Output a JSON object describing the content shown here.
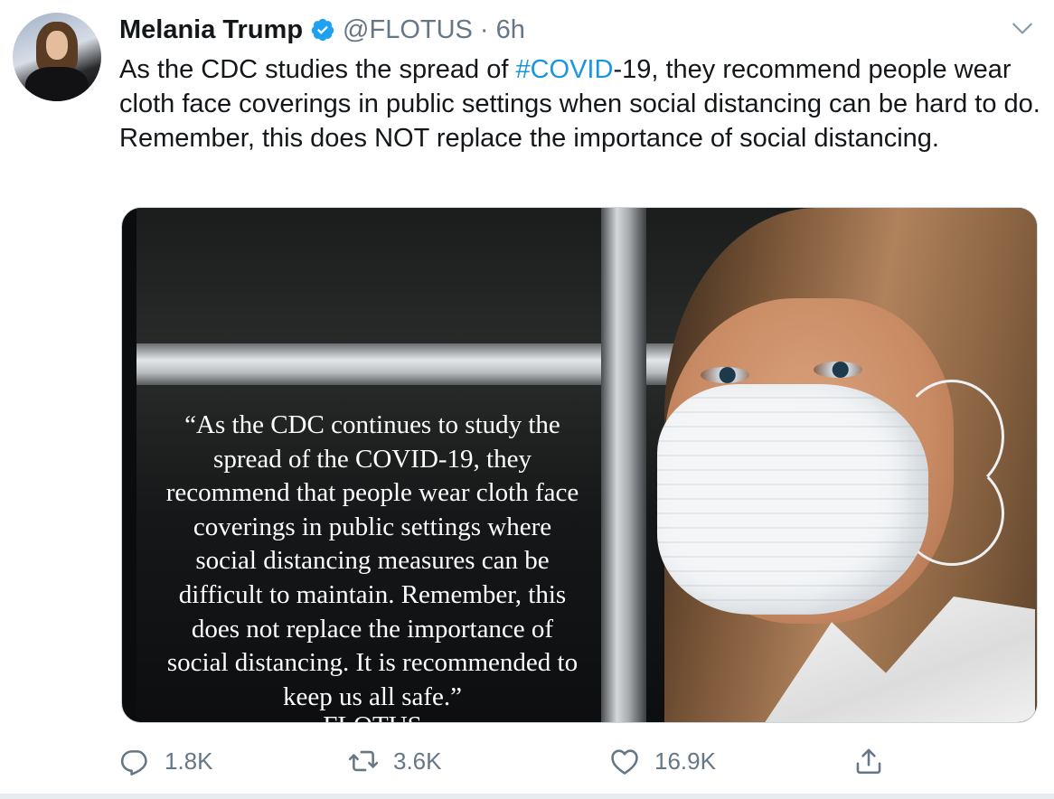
{
  "author": {
    "name": "Melania Trump",
    "handle": "@FLOTUS",
    "separator": "·",
    "time": "6h",
    "verified": true
  },
  "tweet": {
    "text_parts": {
      "before": "As the CDC studies the spread of ",
      "hashtag": "#COVID",
      "after": "-19, they recommend people wear cloth face coverings in public settings when social distancing can be hard to do. Remember, this does NOT replace the importance of social distancing."
    },
    "hashtag_color": "#1b95e0"
  },
  "media": {
    "quote_text": "“As the CDC continues to study the\nspread of the COVID-19, they\nrecommend that people wear cloth face\ncoverings in public settings where\nsocial distancing measures can be\ndifficult to maintain. Remember, this\ndoes not replace the importance of\nsocial distancing. It is recommended to\nkeep us all safe.”",
    "signature": "FLOTUS"
  },
  "actions": {
    "reply_count": "1.8K",
    "retweet_count": "3.6K",
    "like_count": "16.9K",
    "icons": [
      "reply-icon",
      "retweet-icon",
      "like-icon",
      "share-icon"
    ]
  },
  "colors": {
    "text": "#14171a",
    "secondary": "#657786",
    "verified": "#1da1f2",
    "border": "#ccd6dd"
  }
}
